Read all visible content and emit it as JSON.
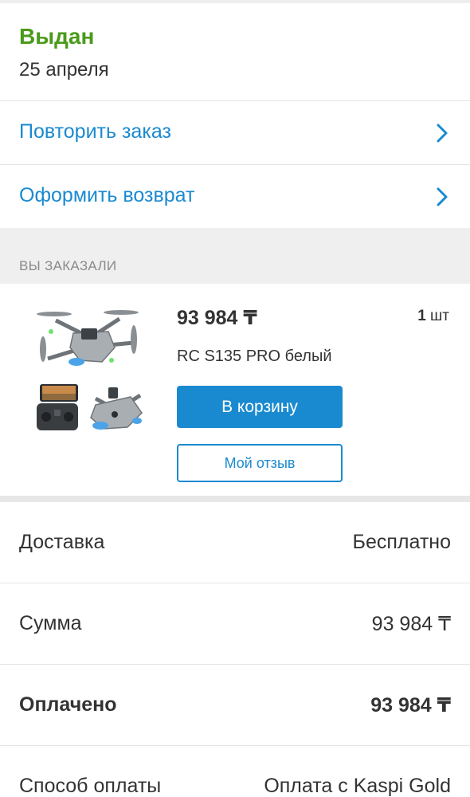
{
  "status": {
    "title": "Выдан",
    "date": "25 апреля"
  },
  "actions": [
    {
      "label": "Повторить заказ",
      "icon": "chevron-right-icon"
    },
    {
      "label": "Оформить возврат",
      "icon": "chevron-right-icon"
    }
  ],
  "ordered_section": {
    "caption": "ВЫ ЗАКАЗАЛИ"
  },
  "product": {
    "price": "93 984 ₸",
    "qty_number": "1",
    "qty_unit": "шт",
    "name": "RC S135 PRO белый",
    "cart_button": "В корзину",
    "review_button": "Мой отзыв",
    "image_icon": "drone-product-image"
  },
  "summary": {
    "delivery_label": "Доставка",
    "delivery_value": "Бесплатно",
    "sum_label": "Сумма",
    "sum_value": "93 984 ₸",
    "paid_label": "Оплачено",
    "paid_value": "93 984 ₸",
    "method_label": "Способ оплаты",
    "method_value": "Оплата с Kaspi Gold"
  },
  "colors": {
    "status_green": "#4a9a1a",
    "accent_blue": "#1a8ad0",
    "gray_bg": "#efefef"
  }
}
